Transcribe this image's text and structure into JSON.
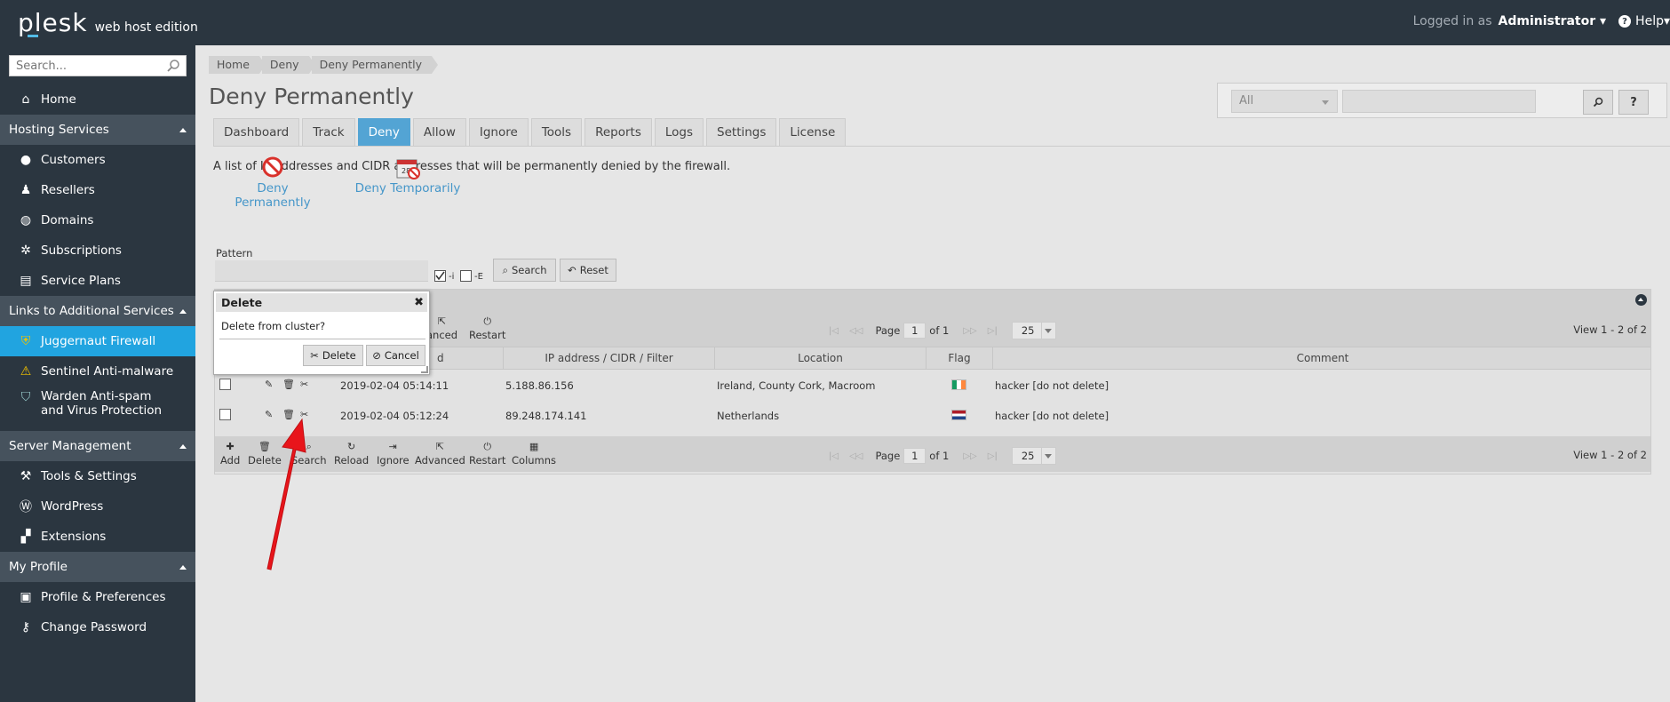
{
  "topbar": {
    "logo": "plesk",
    "edition": "web host edition",
    "logged_in_label": "Logged in as",
    "user": "Administrator",
    "help": "Help"
  },
  "sidebar": {
    "search_placeholder": "Search...",
    "home": "Home",
    "sections": [
      {
        "title": "Hosting Services",
        "items": [
          "Customers",
          "Resellers",
          "Domains",
          "Subscriptions",
          "Service Plans"
        ]
      },
      {
        "title": "Links to Additional Services",
        "items": [
          "Juggernaut Firewall",
          "Sentinel Anti-malware",
          "Warden Anti-spam and Virus Protection"
        ]
      },
      {
        "title": "Server Management",
        "items": [
          "Tools & Settings",
          "WordPress",
          "Extensions"
        ]
      },
      {
        "title": "My Profile",
        "items": [
          "Profile & Preferences",
          "Change Password"
        ]
      }
    ],
    "active_item": "Juggernaut Firewall"
  },
  "breadcrumb": [
    "Home",
    "Deny",
    "Deny Permanently"
  ],
  "page_title": "Deny Permanently",
  "filter": {
    "select_value": "All",
    "search_btn": "⌕",
    "help_btn": "?"
  },
  "tabs": [
    "Dashboard",
    "Track",
    "Deny",
    "Allow",
    "Ignore",
    "Tools",
    "Reports",
    "Logs",
    "Settings",
    "License"
  ],
  "active_tab": "Deny",
  "description": "A list of IP addresses and CIDR addresses that will be permanently denied by the firewall.",
  "big_buttons": [
    "Deny Permanently",
    "Deny Temporarily"
  ],
  "pattern": {
    "label": "Pattern",
    "opt_i": "-i",
    "opt_e": "-E",
    "opt_i_checked": true,
    "opt_e_checked": false,
    "search": "Search",
    "reset": "Reset"
  },
  "toolbar_top": {
    "advanced": "anced",
    "restart": "Restart"
  },
  "toolbar": [
    "Add",
    "Delete",
    "Search",
    "Reload",
    "Ignore",
    "Advanced",
    "Restart",
    "Columns"
  ],
  "pager": {
    "page_label": "Page",
    "page": "1",
    "of": "of 1",
    "per_page": "25",
    "view": "View 1 - 2 of 2"
  },
  "columns": [
    "d",
    "IP address / CIDR / Filter",
    "Location",
    "Flag",
    "Comment"
  ],
  "rows": [
    {
      "date": "2019-02-04 05:14:11",
      "ip": "5.188.86.156",
      "location": "Ireland, County Cork, Macroom",
      "flag": "ireland-flag",
      "comment": "hacker [do not delete]"
    },
    {
      "date": "2019-02-04 05:12:24",
      "ip": "89.248.174.141",
      "location": "Netherlands",
      "flag": "netherlands-flag",
      "comment": "hacker [do not delete]"
    }
  ],
  "dialog": {
    "title": "Delete",
    "message": "Delete from cluster?",
    "delete": "Delete",
    "cancel": "Cancel"
  },
  "colors": {
    "topbar": "#2b3640",
    "accent": "#21a4e0",
    "active_tab": "#53a4d4",
    "link": "#4596c9",
    "arrow": "#e8151b"
  }
}
